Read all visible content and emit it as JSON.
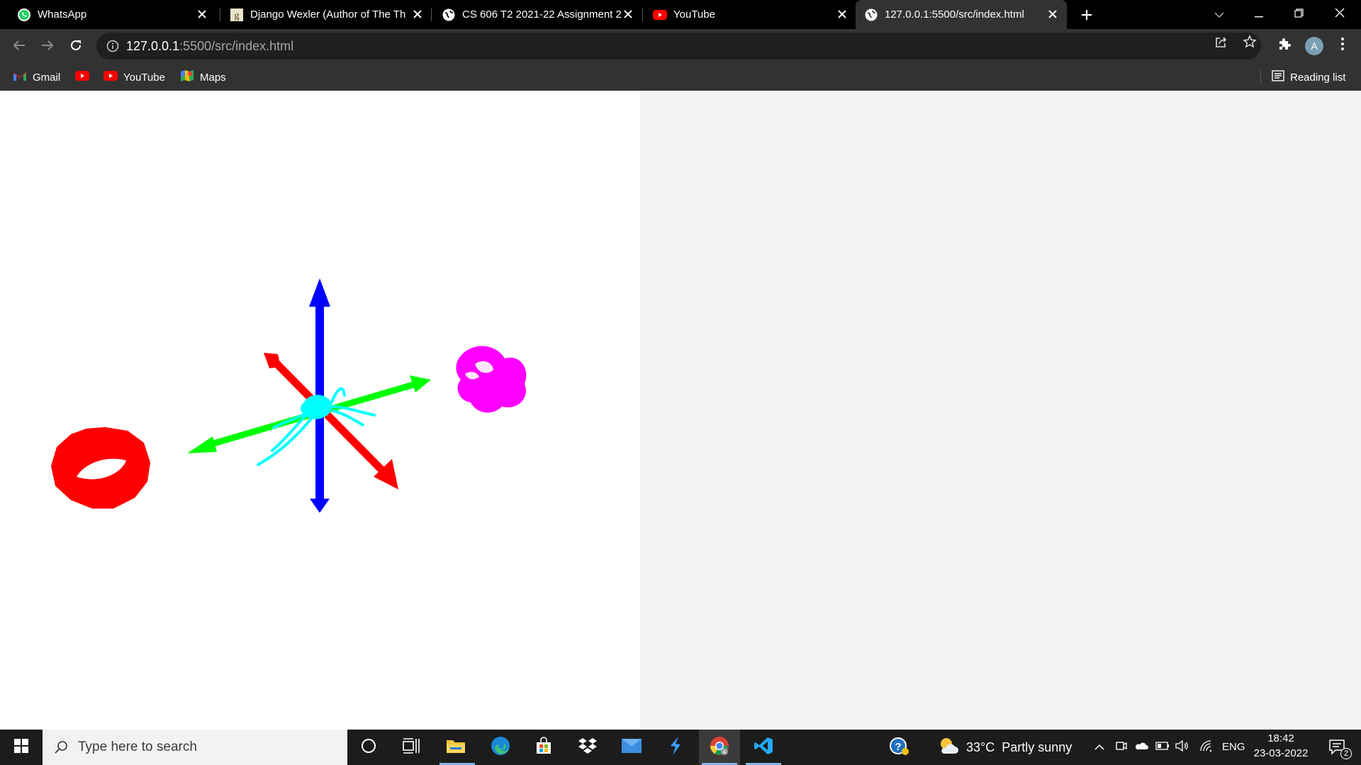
{
  "browser": {
    "tabs": [
      {
        "title": "WhatsApp",
        "icon": "whatsapp-icon"
      },
      {
        "title": "Django Wexler (Author of The Th",
        "icon": "goodreads-icon"
      },
      {
        "title": "CS 606 T2 2021-22 Assignment 2",
        "icon": "globe-icon"
      },
      {
        "title": "YouTube",
        "icon": "youtube-icon"
      },
      {
        "title": "127.0.0.1:5500/src/index.html",
        "icon": "globe-icon",
        "active": true
      }
    ],
    "address": {
      "host": "127.0.0.1",
      "path": ":5500/src/index.html"
    },
    "profile_initial": "A",
    "bookmarks": [
      {
        "label": "Gmail",
        "icon": "gmail-icon"
      },
      {
        "label": "",
        "icon": "youtube-icon"
      },
      {
        "label": "YouTube",
        "icon": "youtube-icon"
      },
      {
        "label": "Maps",
        "icon": "maps-icon"
      }
    ],
    "reading_list": "Reading list"
  },
  "scene": {
    "objects": [
      "red-torus",
      "axes-helper",
      "cyan-model",
      "magenta-knot"
    ],
    "colors": {
      "x_axis": "#ff0000",
      "y_axis": "#0000ff",
      "z_axis": "#00ff00",
      "model": "#00ffff",
      "knot": "#ff00ff",
      "torus": "#ff0000"
    }
  },
  "taskbar": {
    "search_placeholder": "Type here to search",
    "weather": "33°C  Partly sunny",
    "language": "ENG",
    "time": "18:42",
    "date": "23-03-2022",
    "notification_count": "2"
  }
}
